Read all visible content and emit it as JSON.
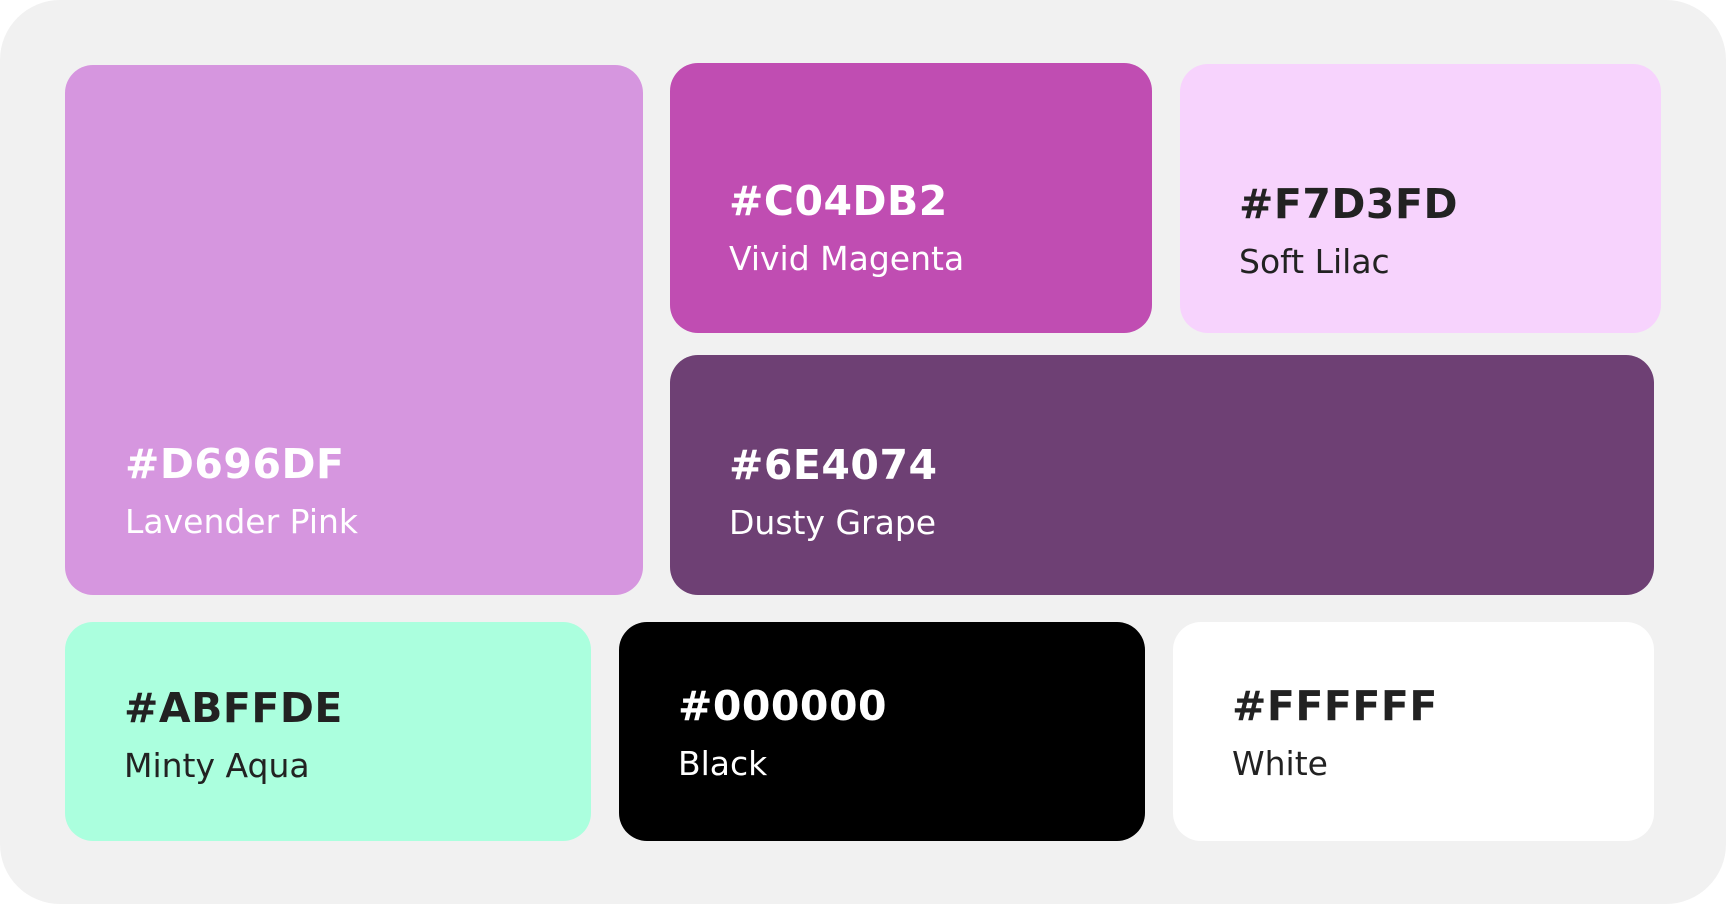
{
  "swatches": [
    {
      "hex": "#D696DF",
      "name": "Lavender Pink",
      "color": "#D696DF"
    },
    {
      "hex": "#C04DB2",
      "name": "Vivid Magenta",
      "color": "#C04DB2"
    },
    {
      "hex": "#F7D3FD",
      "name": "Soft Lilac",
      "color": "#F7D3FD"
    },
    {
      "hex": "#6E4074",
      "name": "Dusty Grape",
      "color": "#6E4074"
    },
    {
      "hex": "#ABFFDE",
      "name": "Minty Aqua",
      "color": "#ABFFDE"
    },
    {
      "hex": "#000000",
      "name": "Black",
      "color": "#000000"
    },
    {
      "hex": "#FFFFFF",
      "name": "White",
      "color": "#FFFFFF"
    }
  ],
  "board_background": "#F1F1F1"
}
